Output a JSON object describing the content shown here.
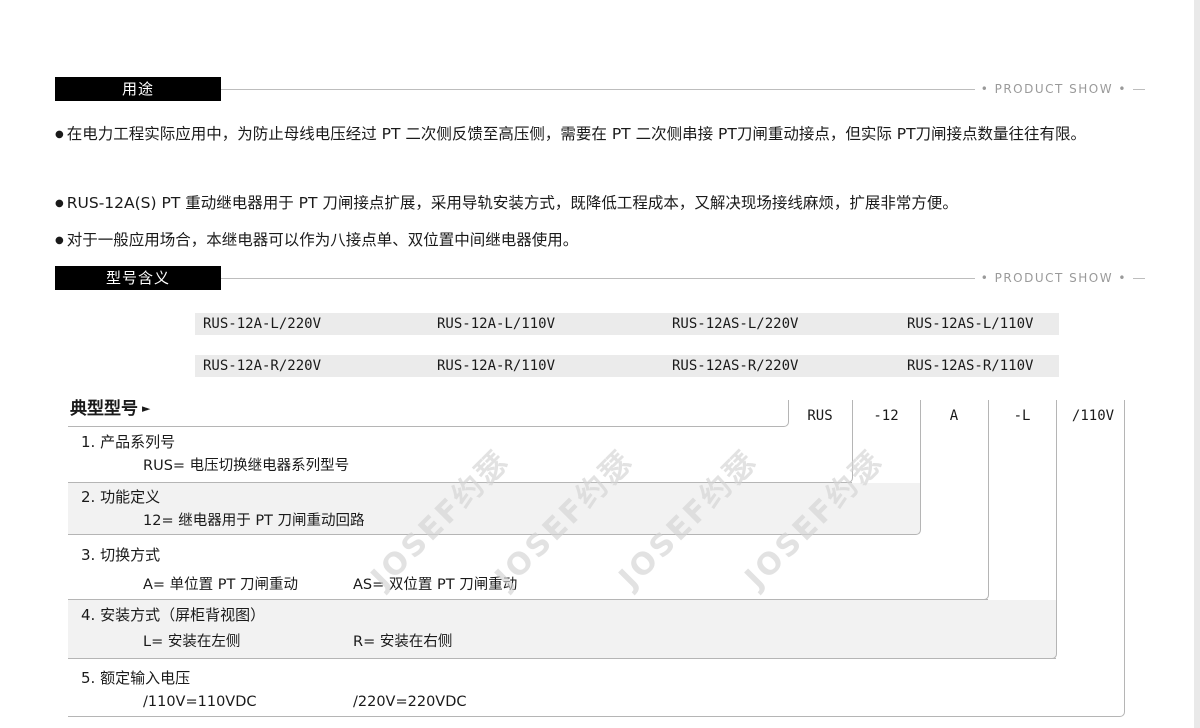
{
  "sections": {
    "usage": {
      "tab": "用途",
      "label": "• PRODUCT SHOW •"
    },
    "model_meaning": {
      "tab": "型号含义",
      "label": "• PRODUCT SHOW •"
    }
  },
  "bullets": [
    "在电力工程实际应用中，为防止母线电压经过 PT 二次侧反馈至高压侧，需要在 PT 二次侧串接 PT刀闸重动接点，但实际 PT刀闸接点数量往往有限。",
    "RUS-12A(S) PT 重动继电器用于 PT 刀闸接点扩展，采用导轨安装方式，既降低工程成本，又解决现场接线麻烦，扩展非常方便。",
    "对于一般应用场合，本继电器可以作为八接点单、双位置中间继电器使用。"
  ],
  "models": {
    "row1": [
      "RUS-12A-L/220V",
      "RUS-12A-L/110V",
      "RUS-12AS-L/220V",
      "RUS-12AS-L/110V"
    ],
    "row2": [
      "RUS-12A-R/220V",
      "RUS-12A-R/110V",
      "RUS-12AS-R/220V",
      "RUS-12AS-R/110V"
    ]
  },
  "typical": {
    "title": "典型型号",
    "arrow": "►",
    "code": [
      "RUS",
      "-12",
      "A",
      "-L",
      "/110V"
    ]
  },
  "fields": [
    {
      "title": "1. 产品系列号",
      "desc": [
        "RUS= 电压切换继电器系列型号"
      ]
    },
    {
      "title": "2. 功能定义",
      "desc": [
        "12= 继电器用于 PT 刀闸重动回路"
      ]
    },
    {
      "title": "3. 切换方式",
      "desc": [
        "A= 单位置 PT 刀闸重动",
        "AS= 双位置 PT 刀闸重动"
      ]
    },
    {
      "title": "4. 安装方式（屏柜背视图）",
      "desc": [
        "L= 安装在左侧",
        "R= 安装在右侧"
      ]
    },
    {
      "title": "5. 额定输入电压",
      "desc": [
        "/110V=110VDC",
        "/220V=220VDC"
      ]
    }
  ],
  "watermark": "JOSEF约瑟"
}
